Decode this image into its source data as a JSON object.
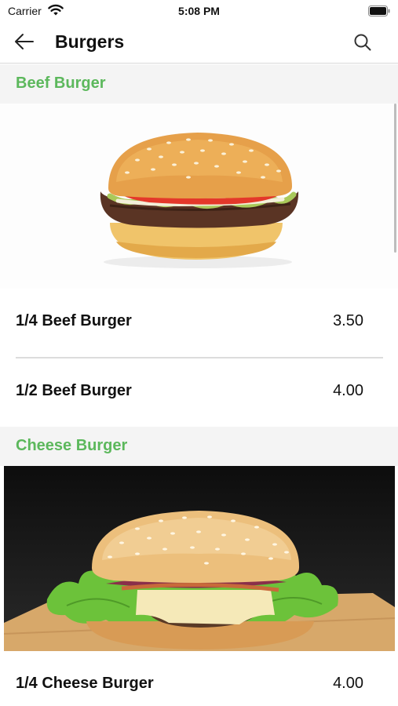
{
  "status_bar": {
    "carrier": "Carrier",
    "time": "5:08 PM"
  },
  "nav": {
    "title": "Burgers",
    "back_icon": "arrow-left-icon",
    "search_icon": "search-icon"
  },
  "colors": {
    "accent": "#5cb85c",
    "section_bg": "#f4f4f4",
    "divider": "#dcdcdc"
  },
  "sections": [
    {
      "title": "Beef Burger",
      "items": [
        {
          "name": "1/4 Beef Burger",
          "price": "3.50"
        },
        {
          "name": "1/2 Beef Burger",
          "price": "4.00"
        }
      ]
    },
    {
      "title": "Cheese Burger",
      "items": [
        {
          "name": "1/4 Cheese Burger",
          "price": "4.00"
        }
      ]
    }
  ]
}
